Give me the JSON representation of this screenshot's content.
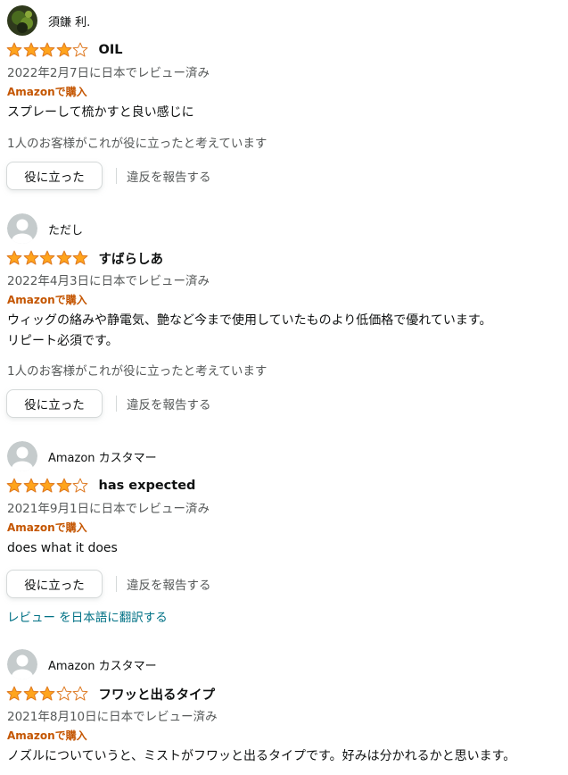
{
  "reviews": [
    {
      "reviewer": "須鎌 利.",
      "avatar_type": "photo-avatar",
      "rating": 4,
      "title": "OIL",
      "date": "2022年2月7日に日本でレビュー済み",
      "verified": "Amazonで購入",
      "body": [
        "スプレーして梳かすと良い感じに"
      ],
      "helpful_count": "1人のお客様がこれが役に立ったと考えています",
      "helpful_button": "役に立った",
      "report": "違反を報告する"
    },
    {
      "reviewer": "ただし",
      "avatar_type": "default-avatar",
      "rating": 5,
      "title": "すばらしあ",
      "date": "2022年4月3日に日本でレビュー済み",
      "verified": "Amazonで購入",
      "body": [
        "ウィッグの絡みや静電気、艶など今まで使用していたものより低価格で優れています。",
        "リピート必須です。"
      ],
      "helpful_count": "1人のお客様がこれが役に立ったと考えています",
      "helpful_button": "役に立った",
      "report": "違反を報告する"
    },
    {
      "reviewer": "Amazon カスタマー",
      "avatar_type": "default-avatar",
      "rating": 4,
      "title": "has expected",
      "date": "2021年9月1日に日本でレビュー済み",
      "verified": "Amazonで購入",
      "body": [
        "does what it does"
      ],
      "helpful_button": "役に立った",
      "report": "違反を報告する",
      "translate": "レビュー を日本語に翻訳する"
    },
    {
      "reviewer": "Amazon カスタマー",
      "avatar_type": "default-avatar",
      "rating": 3,
      "title": "フワッと出るタイプ",
      "date": "2021年8月10日に日本でレビュー済み",
      "verified": "Amazonで購入",
      "body": [
        "ノズルについていうと、ミストがフワッと出るタイプです。好みは分かれるかと思います。"
      ]
    }
  ],
  "colors": {
    "star_filled": "#ffa41c",
    "star_outline": "#de7921",
    "verified": "#c45500",
    "link": "#007185",
    "muted": "#565959"
  }
}
